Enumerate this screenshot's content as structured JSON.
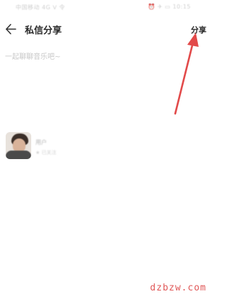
{
  "status_bar": {
    "left_text": "中国移动 4G ᐯ 令",
    "right_text": "⏰ ✈ ▭ 10:15"
  },
  "header": {
    "title": "私信分享",
    "share_label": "分享"
  },
  "message": {
    "placeholder": "一起聊聊音乐吧~"
  },
  "recipient": {
    "name": "用户",
    "subtitle": "★ 已关注"
  },
  "annotation": {
    "color": "#e24a4a"
  },
  "watermark": {
    "text": "dzbzw.com",
    "color": "#e05858"
  },
  "icons": {
    "back": "arrow-left-icon"
  }
}
